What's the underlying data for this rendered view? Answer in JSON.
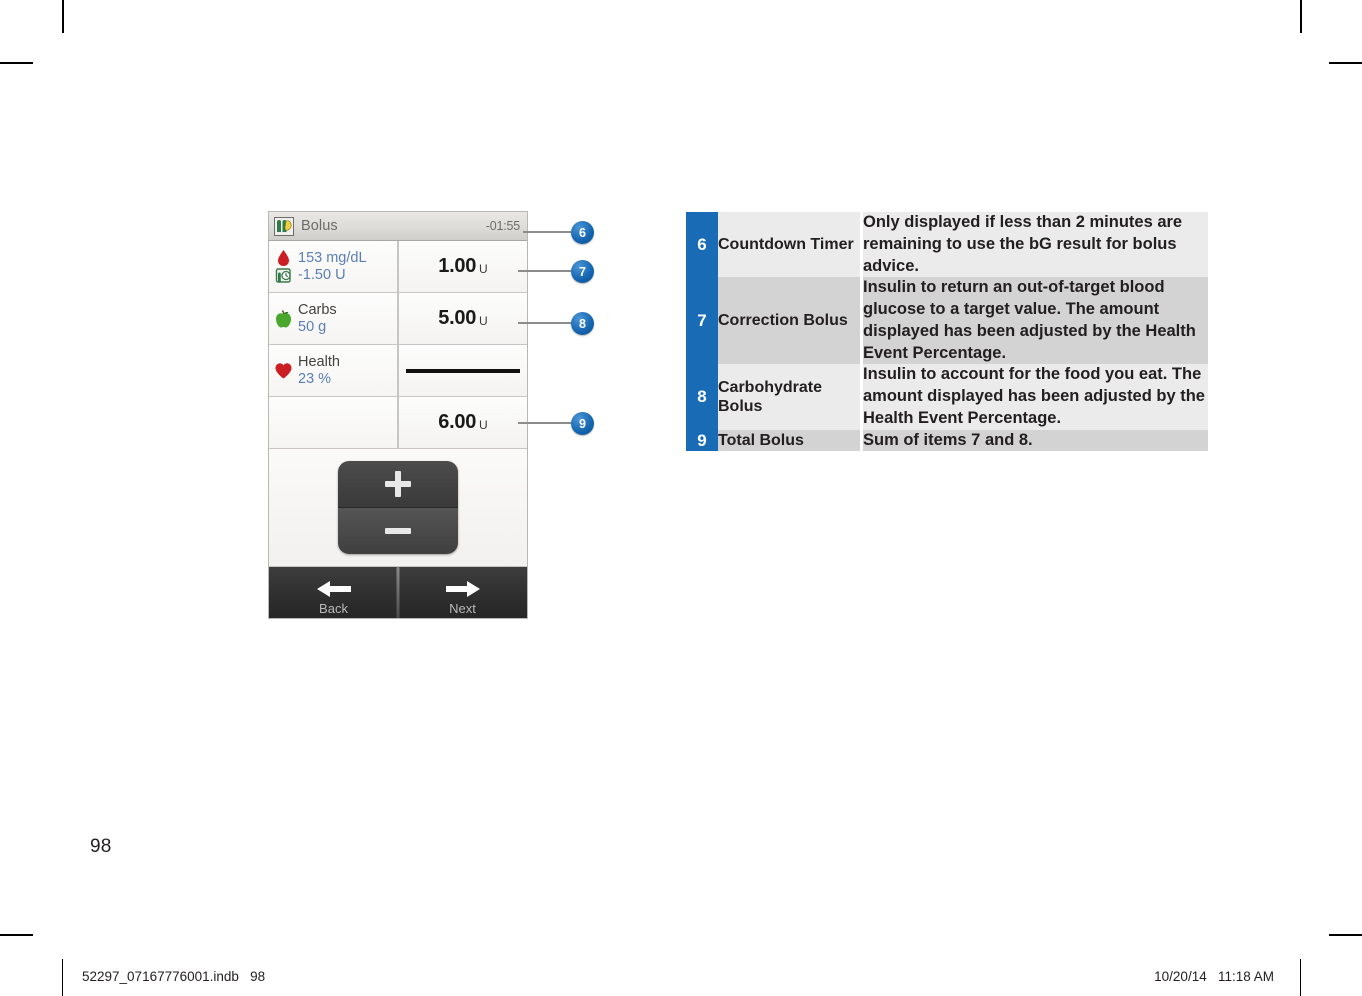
{
  "page": {
    "page_number": "98",
    "footer_left": "52297_07167776001.indb   98",
    "footer_right": "10/20/14   11:18 AM"
  },
  "device_screen": {
    "title": "Bolus",
    "title_icon": "bolus-icon",
    "countdown": "-01:55",
    "rows": [
      {
        "icons": [
          "blood-drop-icon",
          "insulin-on-board-icon"
        ],
        "label_primary": "153 mg/dL",
        "label_secondary": "-1.50 U",
        "value": "1.00",
        "unit": "U"
      },
      {
        "icons": [
          "apple-icon"
        ],
        "label_primary": "Carbs",
        "label_secondary": "50 g",
        "value": "5.00",
        "unit": "U"
      },
      {
        "icons": [
          "heart-icon"
        ],
        "label_primary": "Health",
        "label_secondary": "23 %",
        "value": "",
        "unit": ""
      },
      {
        "icons": [],
        "label_primary": "",
        "label_secondary": "",
        "value": "6.00",
        "unit": "U"
      }
    ],
    "keypad": {
      "increase": "plus-icon",
      "decrease": "minus-icon"
    },
    "nav": {
      "back_label": "Back",
      "back_icon": "arrow-left-icon",
      "next_label": "Next",
      "next_icon": "arrow-right-icon"
    }
  },
  "callouts": [
    {
      "number": "6"
    },
    {
      "number": "7"
    },
    {
      "number": "8"
    },
    {
      "number": "9"
    }
  ],
  "legend": {
    "rows": [
      {
        "number": "6",
        "label": "Countdown Timer",
        "description": "Only displayed if less than 2 minutes are remaining to use the bG result for bolus advice."
      },
      {
        "number": "7",
        "label": "Correction Bolus",
        "description": "Insulin to return an out-of-target blood glucose to a target value. The amount displayed has been adjusted by the Health Event Percentage."
      },
      {
        "number": "8",
        "label": "Carbohydrate Bolus",
        "description": "Insulin to account for the food you eat. The amount displayed has been adjusted by the Health Event Percentage."
      },
      {
        "number": "9",
        "label": "Total Bolus",
        "description": "Sum of items 7 and 8."
      }
    ]
  },
  "colors": {
    "accent_blue": "#1a6bb5",
    "row_light": "#ebebeb",
    "row_dark": "#d3d3d3",
    "text": "#231f20"
  }
}
